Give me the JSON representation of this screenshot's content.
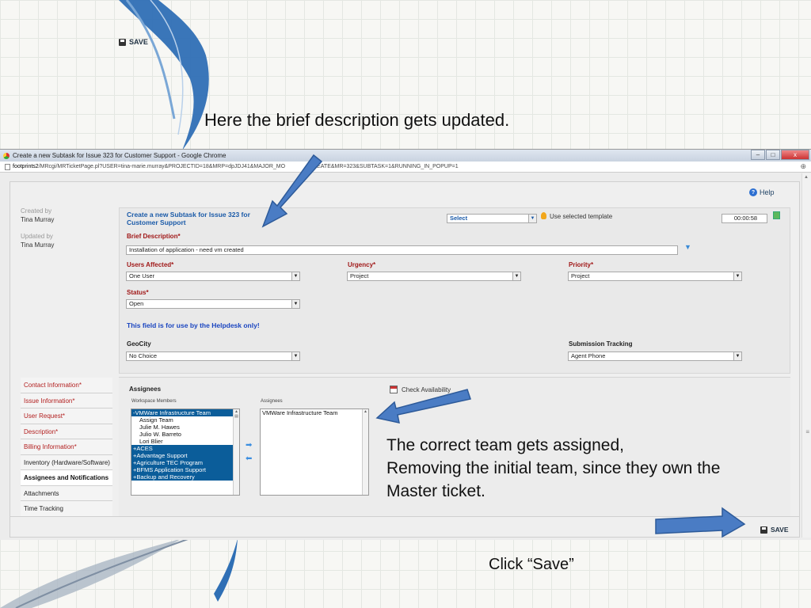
{
  "slide": {
    "caption_top": "Here the brief description gets updated.",
    "caption_mid_lines": [
      "The correct team gets assigned,",
      "Removing the initial team, since they own the",
      "Master ticket."
    ],
    "caption_bottom": "Click “Save”"
  },
  "browser": {
    "window_title": "Create a new Subtask for Issue 323 for Customer Support - Google Chrome",
    "url_host": "footprints2",
    "url_path": "/MRcgi/MRTicketPage.pl?USER=tina-marie.murray&PROJECTID=18&MRP=dpJDJ41&MAJOR_MO",
    "url_tail": "EATE&MR=323&SUBTASK=1&RUNNING_IN_POPUP=1",
    "min": "–",
    "max": "□",
    "close": "x"
  },
  "toolbar": {
    "save_label": "SAVE",
    "help_label": "Help"
  },
  "meta": {
    "created_by_label": "Created by",
    "created_by": "Tina Murray",
    "updated_by_label": "Updated by",
    "updated_by": "Tina Murray"
  },
  "form": {
    "title_line1": "Create a new Subtask for Issue 323 for",
    "title_line2": "Customer Support",
    "template_select": "Select",
    "template_label": "Use selected template",
    "timer": "00:00:58",
    "brief_label": "Brief Description*",
    "brief_value": "Installation of application - need vm created",
    "users_affected_label": "Users Affected*",
    "users_affected_value": "One User",
    "urgency_label": "Urgency*",
    "urgency_value": "Project",
    "priority_label": "Priority*",
    "priority_value": "Project",
    "status_label": "Status*",
    "status_value": "Open",
    "helpdesk_note": "This field is for use by the Helpdesk only!",
    "geocity_label": "GeoCity",
    "geocity_value": "No Choice",
    "submission_label": "Submission Tracking",
    "submission_value": "Agent Phone"
  },
  "nav": {
    "items": [
      {
        "label": "Contact Information*",
        "style": "req"
      },
      {
        "label": "Issue Information*",
        "style": "req"
      },
      {
        "label": "User Request*",
        "style": "req"
      },
      {
        "label": "Description*",
        "style": "req"
      },
      {
        "label": "Billing Information*",
        "style": "req"
      },
      {
        "label": "Inventory (Hardware/Software)",
        "style": "plain"
      },
      {
        "label": "Assignees and Notifications",
        "style": "active"
      },
      {
        "label": "Attachments",
        "style": "plain"
      },
      {
        "label": "Time Tracking",
        "style": "plain"
      }
    ]
  },
  "assignees": {
    "heading": "Assignees",
    "workspace_label": "Workspace Members",
    "assignees_label": "Assignees",
    "check_availability": "Check Availability",
    "workspace_members": [
      {
        "label": "-VMWare Infrastructure Team",
        "sel": true,
        "indent": false
      },
      {
        "label": "Assign Team",
        "sel": false,
        "indent": true
      },
      {
        "label": "Julie M. Hawes",
        "sel": false,
        "indent": true
      },
      {
        "label": "Julio W. Barreto",
        "sel": false,
        "indent": true
      },
      {
        "label": "Lori Blier",
        "sel": false,
        "indent": true
      },
      {
        "label": "+ACES",
        "sel": true,
        "indent": false
      },
      {
        "label": "+Advantage Support",
        "sel": true,
        "indent": false
      },
      {
        "label": "+Agriculture TEC Program",
        "sel": true,
        "indent": false
      },
      {
        "label": "+BFMS Application Support",
        "sel": true,
        "indent": false
      },
      {
        "label": "+Backup and Recovery",
        "sel": true,
        "indent": false
      }
    ],
    "assigned": [
      "VMWare Infrastructure Team"
    ]
  },
  "colors": {
    "accent_blue": "#4a7cc4",
    "required_red": "#a01818",
    "selection": "#0b5d9a"
  }
}
